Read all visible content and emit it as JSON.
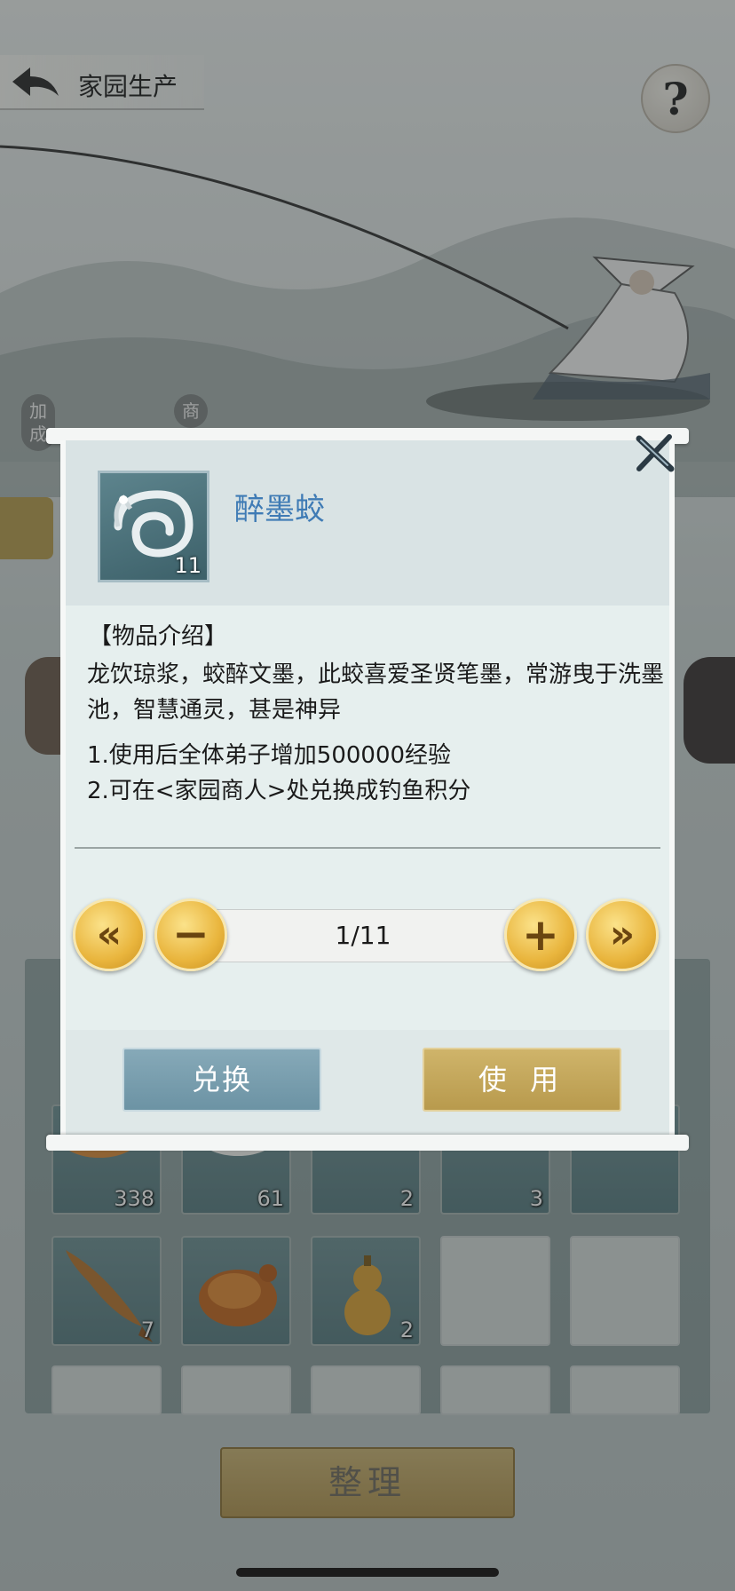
{
  "header": {
    "title": "家园生产",
    "help_label": "?"
  },
  "side_tags": [
    "加成",
    "商"
  ],
  "inventory": {
    "row1": [
      {
        "icon": "pizza-icon",
        "count": "338"
      },
      {
        "icon": "rice-bowl-icon",
        "count": "61"
      },
      {
        "icon": "flatbread-icon",
        "count": "2"
      },
      {
        "icon": "salad-icon",
        "count": "3"
      },
      {
        "icon": "steak-icon",
        "count": ""
      }
    ],
    "row2": [
      {
        "icon": "grilled-fish-icon",
        "count": "7"
      },
      {
        "icon": "roast-chicken-icon",
        "count": ""
      },
      {
        "icon": "gourd-icon",
        "count": "2"
      }
    ],
    "sort_label": "整理"
  },
  "popup": {
    "item_name": "醉墨蛟",
    "item_count": "11",
    "desc_heading": "【物品介绍】",
    "desc_text": "龙饮琼浆，蛟醉文墨，此蛟喜爱圣贤笔墨，常游曳于洗墨池，智慧通灵，甚是神异",
    "effect_1": "1.使用后全体弟子增加500000经验",
    "effect_2": "2.可在<家园商人>处兑换成钓鱼积分",
    "quantity": "1/11",
    "exchange_label": "兑换",
    "use_label": "使 用"
  },
  "colors": {
    "item_name": "#3f7bb5",
    "gold": "#e9b53d",
    "exchange": "#6c93a4",
    "use": "#b89a4d"
  }
}
